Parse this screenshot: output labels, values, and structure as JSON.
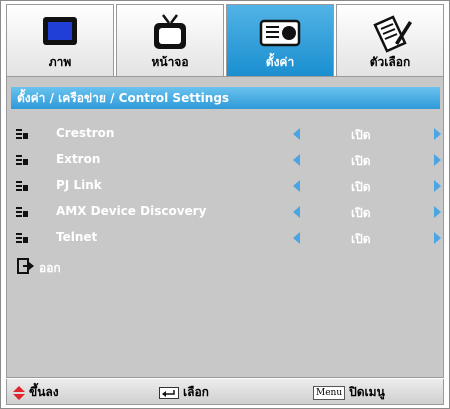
{
  "tabs": [
    {
      "label": "ภาพ",
      "icon": "picture-icon",
      "active": false
    },
    {
      "label": "หน้าจอ",
      "icon": "tv-icon",
      "active": false
    },
    {
      "label": "ตั้งค่า",
      "icon": "projector-icon",
      "active": true
    },
    {
      "label": "ตัวเลือก",
      "icon": "options-icon",
      "active": false
    }
  ],
  "header": {
    "title": "ตั้งค่า / เครือข่าย / Control Settings"
  },
  "items": [
    {
      "label": "Crestron",
      "value": "เปิด"
    },
    {
      "label": "Extron",
      "value": "เปิด"
    },
    {
      "label": "PJ Link",
      "value": "เปิด"
    },
    {
      "label": "AMX Device Discovery",
      "value": "เปิด"
    },
    {
      "label": "Telnet",
      "value": "เปิด"
    }
  ],
  "exit": {
    "label": "ออก"
  },
  "footer": {
    "scroll_label": "ขึ้นลง",
    "select_label": "เลือก",
    "menu_key": "Menu",
    "close_label": "ปิดเมนู"
  },
  "colors": {
    "accent": "#2e9ad8",
    "arrow": "#4aa6e3",
    "panel": "#c8c8c8"
  }
}
